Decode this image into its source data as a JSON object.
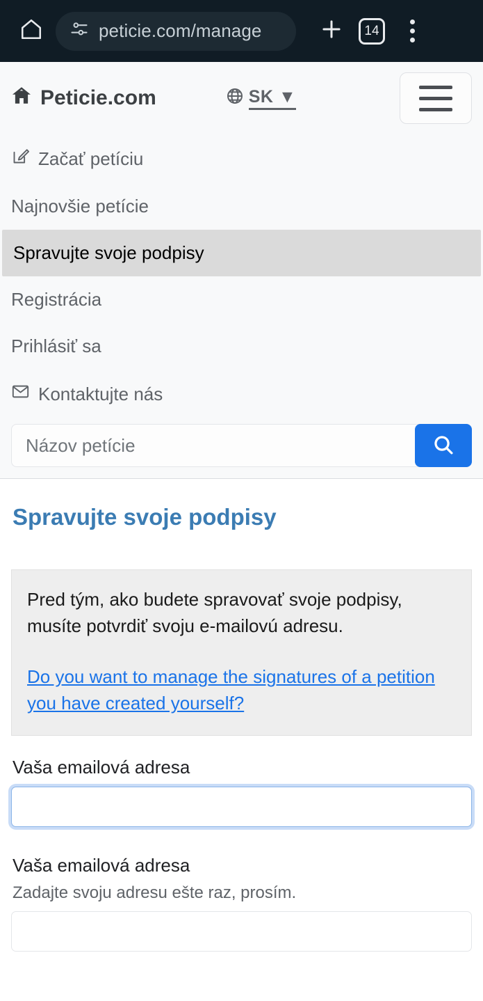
{
  "browser": {
    "home_icon": "home-icon",
    "url": "peticie.com/manage",
    "url_lock_icon": "tune-icon",
    "new_tab_icon": "plus-icon",
    "tab_count": "14",
    "menu_icon": "more-vertical-icon"
  },
  "site": {
    "brand": "Peticie.com",
    "brand_icon": "home-icon",
    "language": {
      "icon": "globe-icon",
      "label": "SK",
      "caret": "▼"
    },
    "menu_button": "hamburger-menu"
  },
  "nav": {
    "items": [
      {
        "label": "Začať petíciu",
        "icon": "edit-square-icon",
        "active": false
      },
      {
        "label": "Najnovšie petície",
        "icon": "",
        "active": false
      },
      {
        "label": "Spravujte svoje podpisy",
        "icon": "",
        "active": true
      },
      {
        "label": "Registrácia",
        "icon": "",
        "active": false
      },
      {
        "label": "Prihlásiť sa",
        "icon": "",
        "active": false
      },
      {
        "label": "Kontaktujte nás",
        "icon": "envelope-icon",
        "active": false
      }
    ]
  },
  "search": {
    "placeholder": "Názov petície",
    "value": "",
    "button_icon": "search-icon",
    "button_color": "#1a73e8"
  },
  "main": {
    "title": "Spravujte svoje podpisy",
    "title_color": "#3b7cb3",
    "notice": {
      "text": "Pred tým, ako budete spravovať svoje podpisy, musíte potvrdiť svoju e-mailovú adresu.",
      "link": "Do you want to manage the signatures of a petition you have created yourself?",
      "link_color": "#1a73e8",
      "background": "#eeeeee"
    },
    "form": {
      "email_label": "Vaša emailová adresa",
      "email_value": "",
      "email_placeholder": "",
      "email_confirm_label": "Vaša emailová adresa",
      "email_confirm_hint": "Zadajte svoju adresu ešte raz, prosím.",
      "email_confirm_value": "",
      "email_confirm_placeholder": ""
    }
  }
}
